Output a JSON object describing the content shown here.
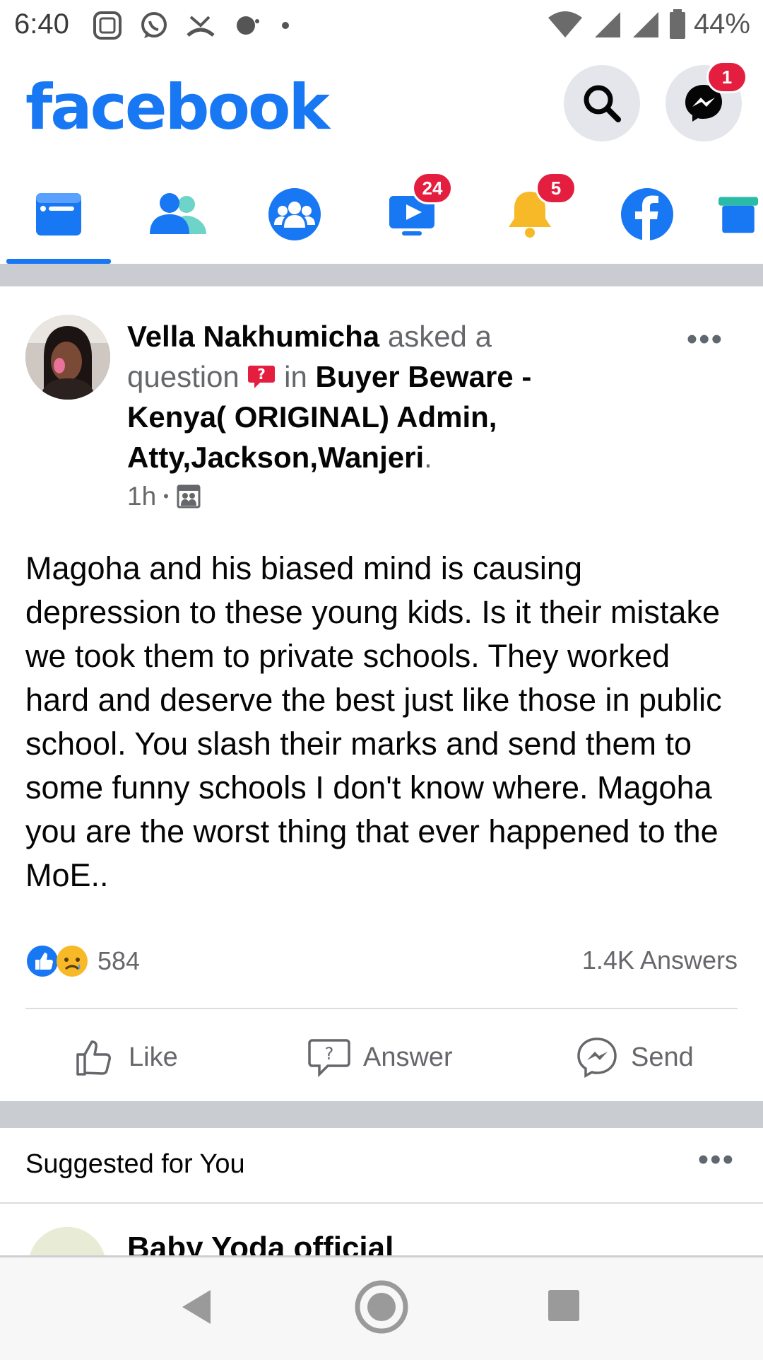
{
  "status_bar": {
    "time": "6:40",
    "battery": "44%"
  },
  "header": {
    "logo": "facebook",
    "messenger_badge": "1"
  },
  "tabs": [
    {
      "name": "home",
      "badge": ""
    },
    {
      "name": "friends",
      "badge": ""
    },
    {
      "name": "groups",
      "badge": ""
    },
    {
      "name": "watch",
      "badge": "24"
    },
    {
      "name": "notifications",
      "badge": "5"
    },
    {
      "name": "facebook",
      "badge": ""
    },
    {
      "name": "marketplace",
      "badge": ""
    }
  ],
  "post": {
    "author": "Vella Nakhumicha",
    "action_text": "asked a question",
    "in_text": "in",
    "group": "Buyer Beware - Kenya( ORIGINAL) Admin, Atty,Jackson,Wanjeri",
    "period": ".",
    "time": "1h",
    "dot": "•",
    "more_icon": "•••",
    "body": "Magoha and his biased mind is causing depression to these young kids. Is it their mistake we took them to private schools. They worked hard and deserve the best just like those in public school. You slash their marks and send them to some funny schools I don't know where. Magoha you are the worst thing that ever happened to the MoE..",
    "reaction_count": "584",
    "answers_count": "1.4K Answers",
    "actions": {
      "like": "Like",
      "answer": "Answer",
      "send": "Send"
    }
  },
  "suggested": {
    "title": "Suggested for You",
    "more_icon": "•••",
    "page_name": "Baby Yoda official"
  },
  "colors": {
    "brand": "#1877f2",
    "badge": "#e41e3f",
    "separator": "#c9ccd1",
    "secondary_text": "#65676b"
  }
}
